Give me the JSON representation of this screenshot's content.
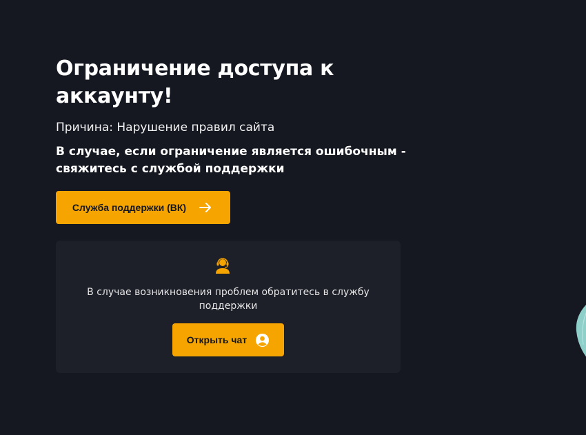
{
  "page": {
    "title": "Ограничение доступа к аккаунту!",
    "reason": "Причина: Нарушение правил сайта",
    "notice": "В случае, если ограничение является ошибочным - свяжитесь с службой поддержки"
  },
  "support_button": {
    "label": "Служба поддержки (ВК)",
    "icon": "arrow-right-icon"
  },
  "help_card": {
    "icon": "support-agent-icon",
    "text": "В случае возникновения проблем обратитесь в службу поддержки",
    "chat_button_label": "Открыть чат",
    "chat_button_icon": "user-circle-icon"
  },
  "colors": {
    "background": "#151821",
    "card_background": "#1d1f29",
    "accent": "#f5a400",
    "decoration": "#8ecfca"
  }
}
